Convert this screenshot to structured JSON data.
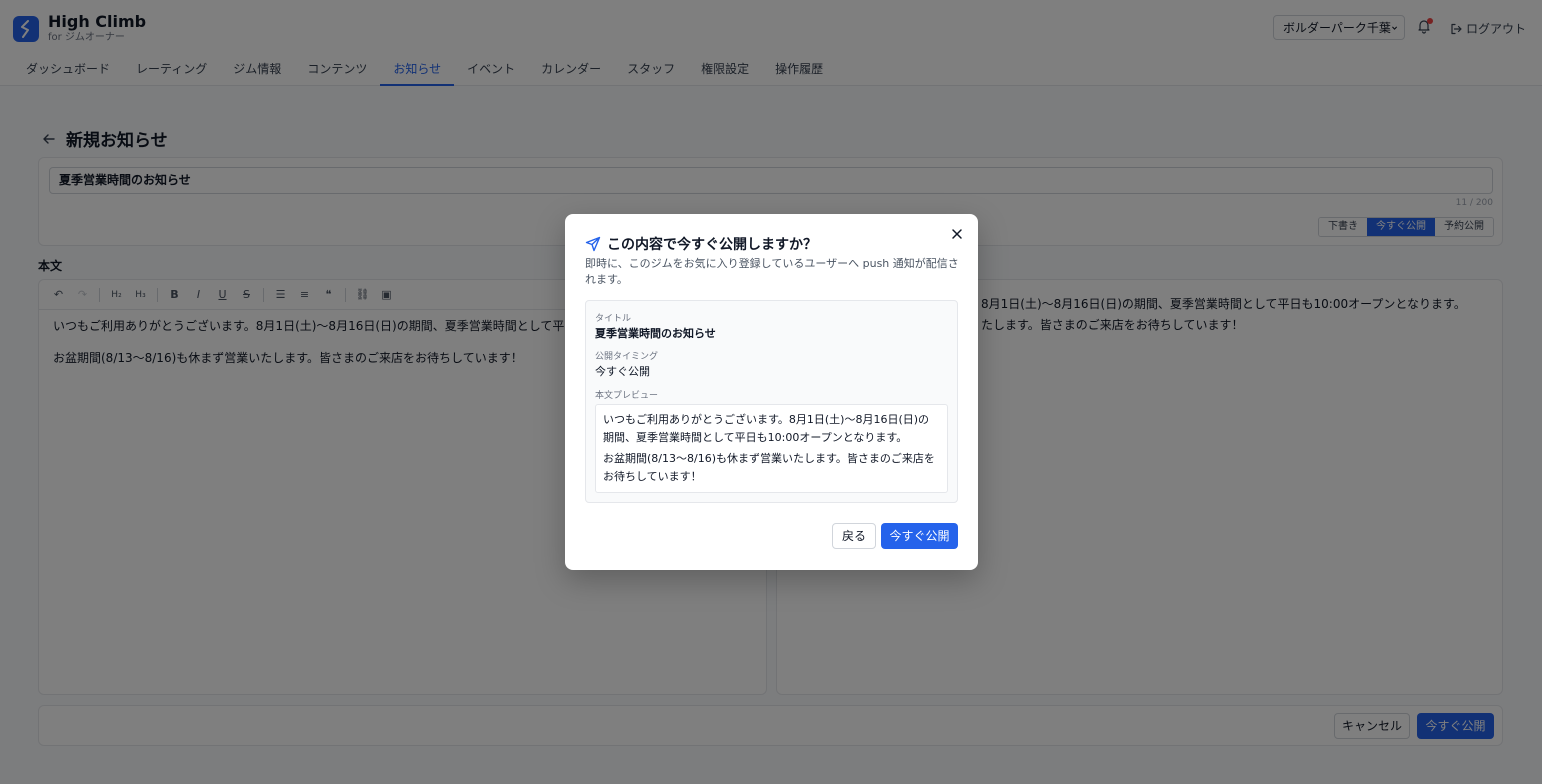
{
  "header": {
    "brand_name": "High Climb",
    "brand_sub": "for ジムオーナー",
    "gym_select": "ボルダーパーク千葉",
    "logout_label": "ログアウト"
  },
  "nav": {
    "tabs": [
      "ダッシュボード",
      "レーティング",
      "ジム情報",
      "コンテンツ",
      "お知らせ",
      "イベント",
      "カレンダー",
      "スタッフ",
      "権限設定",
      "操作履歴"
    ],
    "active": "お知らせ"
  },
  "page": {
    "title": "新規お知らせ",
    "title_input_value": "夏季営業時間のお知らせ",
    "char_count": "11 / 200",
    "publish_modes": [
      "下書き",
      "今すぐ公開",
      "予約公開"
    ],
    "active_mode": "今すぐ公開",
    "body_label": "本文",
    "editor_toolbar": [
      "undo",
      "redo",
      "H2",
      "H3",
      "bold",
      "italic",
      "underline",
      "strike",
      "bullet-list",
      "ordered-list",
      "quote",
      "link",
      "image"
    ],
    "editor_paragraphs": [
      "いつもご利用ありがとうございます。8月1日(土)〜8月16日(日)の期間、夏季営業時間として平日も10:00オープンとなります。",
      "お盆期間(8/13〜8/16)も休まず営業いたします。皆さまのご来店をお待ちしています！"
    ],
    "preview_paragraphs": [
      "8月1日(土)〜8月16日(日)の期間、夏季営業時間として平日も10:00オープンとなります。",
      "たします。皆さまのご来店をお待ちしています！"
    ],
    "cancel_label": "キャンセル",
    "publish_label": "今すぐ公開"
  },
  "modal": {
    "title": "この内容で今すぐ公開しますか？",
    "description": "即時に、このジムをお気に入り登録しているユーザーへ push 通知が配信されます。",
    "title_label": "タイトル",
    "title_value": "夏季営業時間のお知らせ",
    "timing_label": "公開タイミング",
    "timing_value": "今すぐ公開",
    "preview_label": "本文プレビュー",
    "preview_p1": "いつもご利用ありがとうございます。8月1日(土)〜8月16日(日)の期間、夏季営業時間として平日も10:00オープンとなります。",
    "preview_p2": "お盆期間(8/13〜8/16)も休まず営業いたします。皆さまのご来店をお待ちしています！",
    "back_label": "戻る",
    "confirm_label": "今すぐ公開"
  },
  "colors": {
    "accent": "#2563eb",
    "notification_dot": "#ef4444"
  }
}
